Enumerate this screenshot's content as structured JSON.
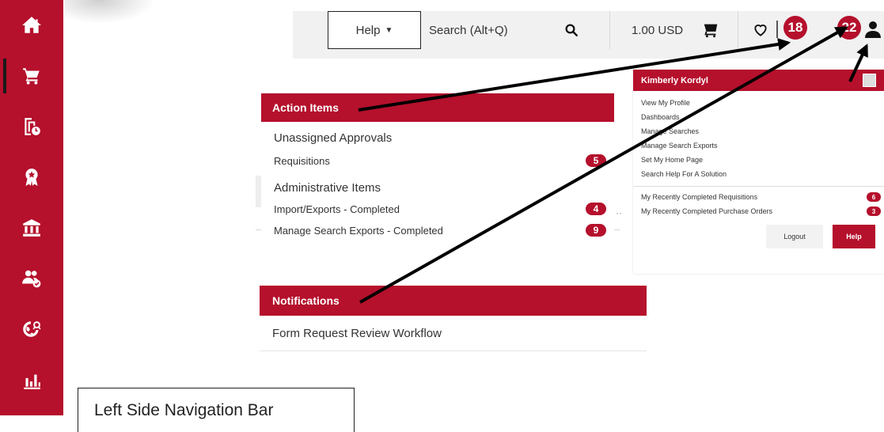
{
  "sidebar": {
    "items": [
      {
        "icon": "home-icon"
      },
      {
        "icon": "cart-icon",
        "active": true
      },
      {
        "icon": "documents-clock-icon"
      },
      {
        "icon": "award-ribbon-icon"
      },
      {
        "icon": "bank-icon"
      },
      {
        "icon": "users-check-icon"
      },
      {
        "icon": "globe-network-icon"
      },
      {
        "icon": "bar-chart-icon"
      }
    ]
  },
  "topbar": {
    "help_label": "Help",
    "search_label": "Search (Alt+Q)",
    "currency": "1.00 USD",
    "action_badge": "18",
    "notification_badge": "22"
  },
  "user_panel": {
    "name": "Kimberly Kordyl",
    "links": [
      "View My Profile",
      "Dashboards",
      "Manage Searches",
      "Manage Search Exports",
      "Set My Home Page",
      "Search Help For A Solution"
    ],
    "recent": [
      {
        "label": "My Recently Completed Requisitions",
        "count": "6"
      },
      {
        "label": "My Recently Completed Purchase Orders",
        "count": "3"
      }
    ],
    "logout_label": "Logout",
    "help_label": "Help"
  },
  "action_items": {
    "title": "Action Items",
    "sections": [
      {
        "title": "Unassigned Approvals",
        "items": [
          {
            "label": "Requisitions",
            "count": "5"
          }
        ]
      },
      {
        "title": "Administrative Items",
        "items": [
          {
            "label": "Import/Exports - Completed",
            "count": "4"
          },
          {
            "label": "Manage Search Exports - Completed",
            "count": "9"
          }
        ]
      }
    ]
  },
  "notifications": {
    "title": "Notifications",
    "items": [
      "Form Request Review Workflow"
    ]
  },
  "caption": "Left Side Navigation Bar",
  "colors": {
    "brand": "#b5102c",
    "annotation": "#000000"
  }
}
